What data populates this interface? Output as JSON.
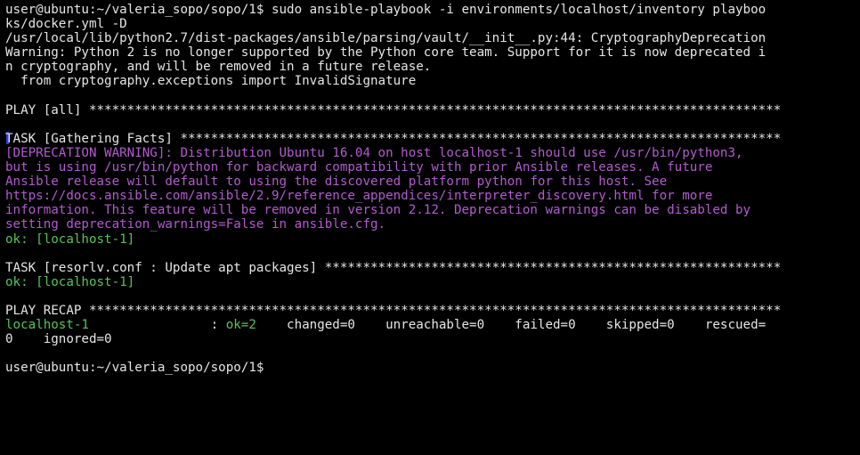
{
  "terminal": {
    "lines": [
      [
        {
          "text": "user@ubuntu:~/valeria_sopo/sopo/1$ sudo ansible-playbook -i environments/localhost/inventory playboo",
          "color": "default"
        }
      ],
      [
        {
          "text": "ks/docker.yml -D",
          "color": "default"
        }
      ],
      [
        {
          "text": "/usr/local/lib/python2.7/dist-packages/ansible/parsing/vault/__init__.py:44: CryptographyDeprecation",
          "color": "default"
        }
      ],
      [
        {
          "text": "Warning: Python 2 is no longer supported by the Python core team. Support for it is now deprecated i",
          "color": "default"
        }
      ],
      [
        {
          "text": "n cryptography, and will be removed in a future release.",
          "color": "default"
        }
      ],
      [
        {
          "text": "  from cryptography.exceptions import InvalidSignature",
          "color": "default"
        }
      ],
      [
        {
          "text": "",
          "color": "default"
        }
      ],
      [
        {
          "text": "PLAY [all] *******************************************************************************************",
          "color": "default"
        }
      ],
      [
        {
          "text": "",
          "color": "default"
        }
      ],
      [
        {
          "text": "TASK [Gathering Facts] *******************************************************************************",
          "color": "default"
        }
      ],
      [
        {
          "text": "[DEPRECATION WARNING]: Distribution Ubuntu 16.04 on host localhost-1 should use /usr/bin/python3,",
          "color": "magenta"
        }
      ],
      [
        {
          "text": "but is using /usr/bin/python for backward compatibility with prior Ansible releases. A future",
          "color": "magenta"
        }
      ],
      [
        {
          "text": "Ansible release will default to using the discovered platform python for this host. See",
          "color": "magenta"
        }
      ],
      [
        {
          "text": "https://docs.ansible.com/ansible/2.9/reference_appendices/interpreter_discovery.html for more",
          "color": "magenta"
        }
      ],
      [
        {
          "text": "information. This feature will be removed in version 2.12. Deprecation warnings can be disabled by",
          "color": "magenta"
        }
      ],
      [
        {
          "text": "setting deprecation_warnings=False in ansible.cfg.",
          "color": "magenta"
        }
      ],
      [
        {
          "text": "ok: [localhost-1]",
          "color": "green"
        }
      ],
      [
        {
          "text": "",
          "color": "default"
        }
      ],
      [
        {
          "text": "TASK [resorlv.conf : Update apt packages] ************************************************************",
          "color": "default"
        }
      ],
      [
        {
          "text": "ok: [localhost-1]",
          "color": "green"
        }
      ],
      [
        {
          "text": "",
          "color": "default"
        }
      ],
      [
        {
          "text": "PLAY RECAP *******************************************************************************************",
          "color": "default"
        }
      ],
      [
        {
          "text": "localhost-1",
          "color": "green"
        },
        {
          "text": "                : ",
          "color": "default"
        },
        {
          "text": "ok=2",
          "color": "green"
        },
        {
          "text": "    changed=0    unreachable=0    failed=0    skipped=0    rescued=",
          "color": "default"
        }
      ],
      [
        {
          "text": "0    ignored=0",
          "color": "default"
        }
      ],
      [
        {
          "text": "",
          "color": "default"
        }
      ],
      [
        {
          "text": "user@ubuntu:~/valeria_sopo/sopo/1$",
          "color": "default"
        }
      ]
    ]
  },
  "colors": {
    "background": "#000000",
    "default_text": "#e6e6e6",
    "warning_magenta": "#b25bcf",
    "ok_green": "#58c35a",
    "cursor_blue": "#2f3ed8"
  }
}
